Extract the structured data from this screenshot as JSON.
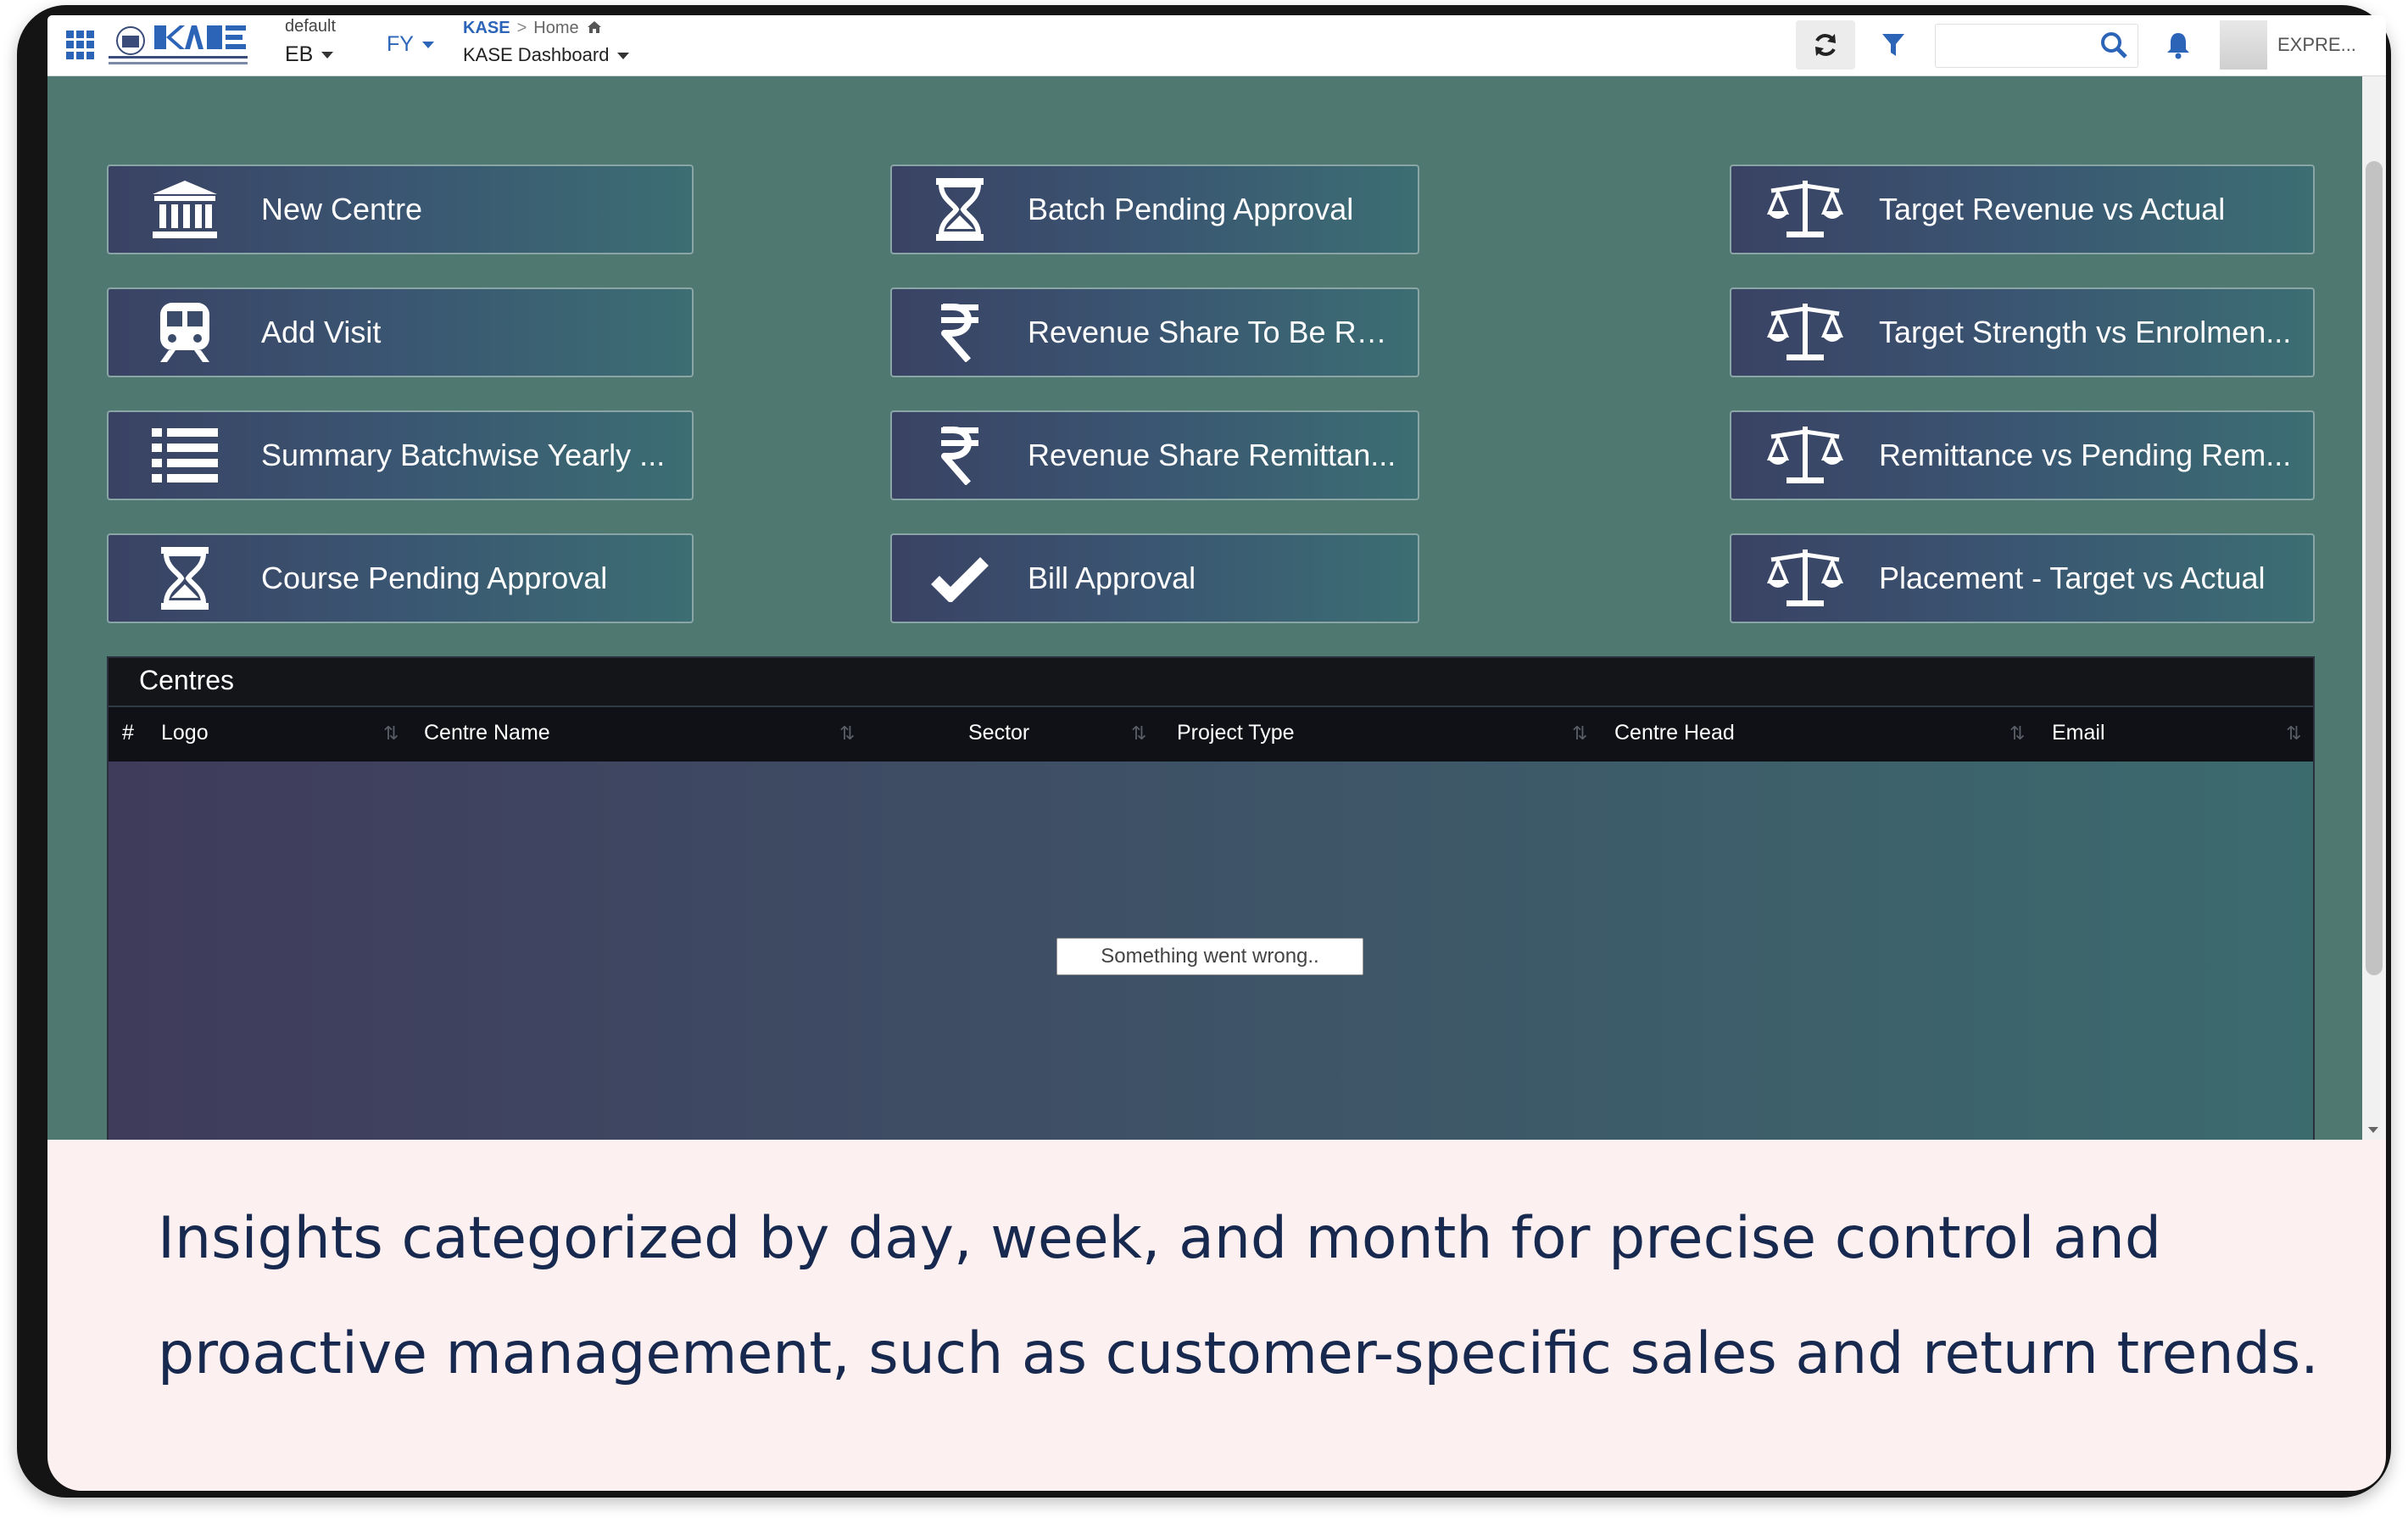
{
  "topbar": {
    "context_small": "default",
    "context_value": "EB",
    "fy_label": "FY",
    "breadcrumb_root": "KASE",
    "breadcrumb_sep": ">",
    "breadcrumb_home": "Home",
    "dashboard_title": "KASE Dashboard",
    "search_placeholder": "",
    "user_name": "EXPRE..."
  },
  "tiles": [
    {
      "label": "New Centre",
      "icon": "bank-icon"
    },
    {
      "label": "Add Visit",
      "icon": "train-icon"
    },
    {
      "label": "Summary Batchwise Yearly ...",
      "icon": "list-icon"
    },
    {
      "label": "Course Pending Approval",
      "icon": "hourglass-icon"
    },
    {
      "label": "Batch Pending Approval",
      "icon": "hourglass-icon"
    },
    {
      "label": "Revenue Share To Be Re...",
      "icon": "rupee-icon"
    },
    {
      "label": "Revenue Share Remittan...",
      "icon": "rupee-icon"
    },
    {
      "label": "Bill Approval",
      "icon": "check-icon"
    },
    {
      "label": "Target Revenue vs Actual",
      "icon": "scale-icon"
    },
    {
      "label": "Target Strength vs Enrolmen...",
      "icon": "scale-icon"
    },
    {
      "label": "Remittance vs Pending Rem...",
      "icon": "scale-icon"
    },
    {
      "label": "Placement - Target vs Actual",
      "icon": "scale-icon"
    }
  ],
  "centres": {
    "title": "Centres",
    "columns": [
      "#",
      "Logo",
      "Centre Name",
      "Sector",
      "Project Type",
      "Centre Head",
      "Email"
    ],
    "sort_glyph": "⇅",
    "error_message": "Something went wrong.."
  },
  "caption": "Insights categorized by day, week, and month for precise control and proactive management, such as customer-specific sales and return trends.",
  "colors": {
    "background": "#4e7870",
    "tile_gradient_start": "#3a4264",
    "tile_gradient_end": "#3c6e73",
    "caption_text": "#17294e",
    "caption_bg": "#fdf0f0"
  }
}
